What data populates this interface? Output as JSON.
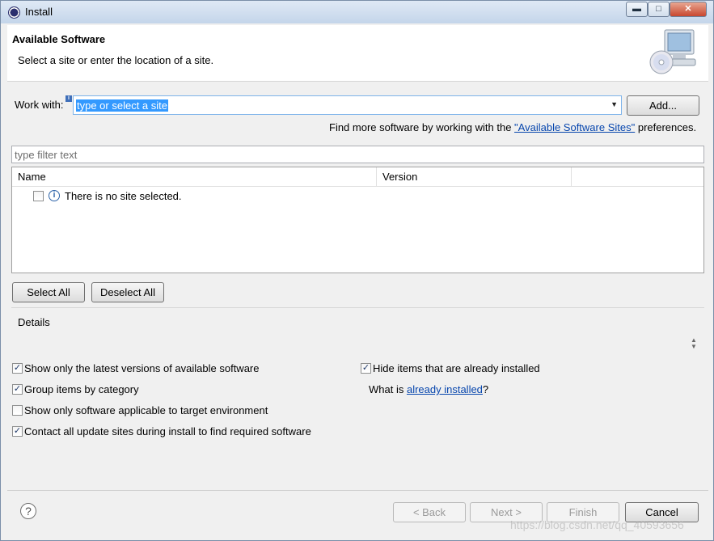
{
  "window": {
    "title": "Install"
  },
  "header": {
    "title": "Available Software",
    "description": "Select a site or enter the location of a site."
  },
  "work_with": {
    "label": "Work with:",
    "value": "type or select a site",
    "add_button": "Add...",
    "hint_before": "Find more software by working with the ",
    "hint_link": "\"Available Software Sites\"",
    "hint_after": " preferences."
  },
  "filter": {
    "placeholder": "type filter text"
  },
  "table": {
    "columns": [
      "Name",
      "Version"
    ],
    "message": "There is no site selected."
  },
  "selection": {
    "select_all": "Select All",
    "deselect_all": "Deselect All"
  },
  "details": {
    "title": "Details"
  },
  "options": {
    "latest_versions": {
      "label": "Show only the latest versions of available software",
      "checked": true
    },
    "group_by_category": {
      "label": "Group items by category",
      "checked": true
    },
    "target_env": {
      "label": "Show only software applicable to target environment",
      "checked": false
    },
    "contact_sites": {
      "label": "Contact all update sites during install to find required software",
      "checked": true
    },
    "hide_installed": {
      "label": "Hide items that are already installed",
      "checked": true
    },
    "what_is_before": "What is ",
    "what_is_link": "already installed",
    "what_is_after": "?"
  },
  "footer": {
    "back": "< Back",
    "next": "Next >",
    "finish": "Finish",
    "cancel": "Cancel"
  },
  "watermark": "https://blog.csdn.net/qq_40593656"
}
